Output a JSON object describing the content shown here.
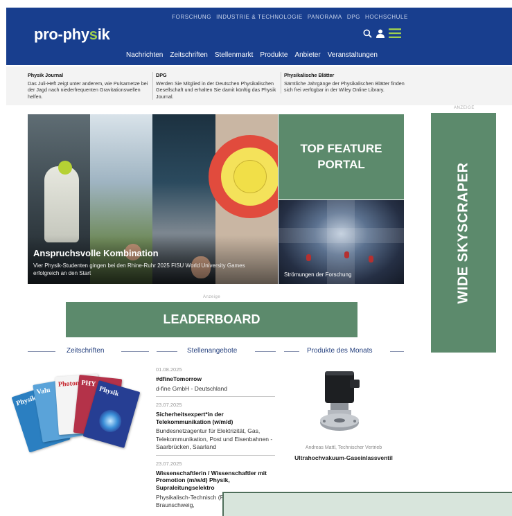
{
  "header": {
    "logo_main": "pro-phy",
    "logo_accent": "s",
    "logo_tail": "ik",
    "top_nav": [
      "FORSCHUNG",
      "INDUSTRIE & TECHNOLOGIE",
      "PANORAMA",
      "DPG",
      "HOCHSCHULE"
    ],
    "main_nav": [
      "Nachrichten",
      "Zeitschriften",
      "Stellenmarkt",
      "Produkte",
      "Anbieter",
      "Veranstaltungen"
    ],
    "icons": [
      "search-icon",
      "user-icon",
      "menu-icon"
    ],
    "color_bg": "#183e8e",
    "color_accent": "#9fd04f"
  },
  "infobar": [
    {
      "title": "Physik Journal",
      "text": "Das Juli-Heft zeigt unter anderem, wie Pulsarnetze bei der Jagd nach niederfrequenten Gravitationswellen helfen."
    },
    {
      "title": "DPG",
      "text": "Werden Sie Mitglied in der Deutschen Physikalischen Gesellschaft und erhalten Sie damit künftig das Physik Journal."
    },
    {
      "title": "Physikalische Blätter",
      "text": "Sämtliche Jahrgänge der Physikalischen Blätter finden sich frei verfügbar in der Wiley Online Library."
    }
  ],
  "ad_label_top": "ANZEIGE",
  "ad_label_mid": "Anzeige",
  "hero": {
    "title": "Anspruchsvolle Kombination",
    "subtitle": "Vier Physik-Studenten gingen bei den Rhine-Ruhr 2025 FISU World University Games erfolgreich an den Start"
  },
  "feature_box": "TOP FEATURE PORTAL",
  "flow_caption": "Strömungen der Forschung",
  "skyscraper": "WIDE SKYSCRAPER",
  "leaderboard": "LEADERBOARD",
  "sections": {
    "zeitschriften": "Zeitschriften",
    "stellenangebote": "Stellenangebote",
    "produkte": "Produkte des Monats"
  },
  "magazines": [
    "Physik",
    "Valu",
    "Photon",
    "PHY",
    "Physik"
  ],
  "jobs": [
    {
      "date": "01.08.2025",
      "title": "#dfineTomorrow",
      "company": "d-fine GmbH - Deutschland"
    },
    {
      "date": "23.07.2025",
      "title": "Sicherheitsexpert*in der Telekommunikation (w/m/d)",
      "company": "Bundesnetzagentur für Elektrizität, Gas, Telekommunikation, Post und Eisenbahnen - Saarbrücken, Saarland"
    },
    {
      "date": "23.07.2025",
      "title": "Wissenschaftlerin / Wissenschaftler mit Promotion (m/w/d) Physik, Supraleitungselektro",
      "company": "Physikalisch-Technisch (PTB) - Braunschweig,"
    }
  ],
  "product": {
    "vendor": "Andreas Mattl, Technischer Vertrieb",
    "name": "Ultrahochvakuum-Gaseinlassventil"
  }
}
